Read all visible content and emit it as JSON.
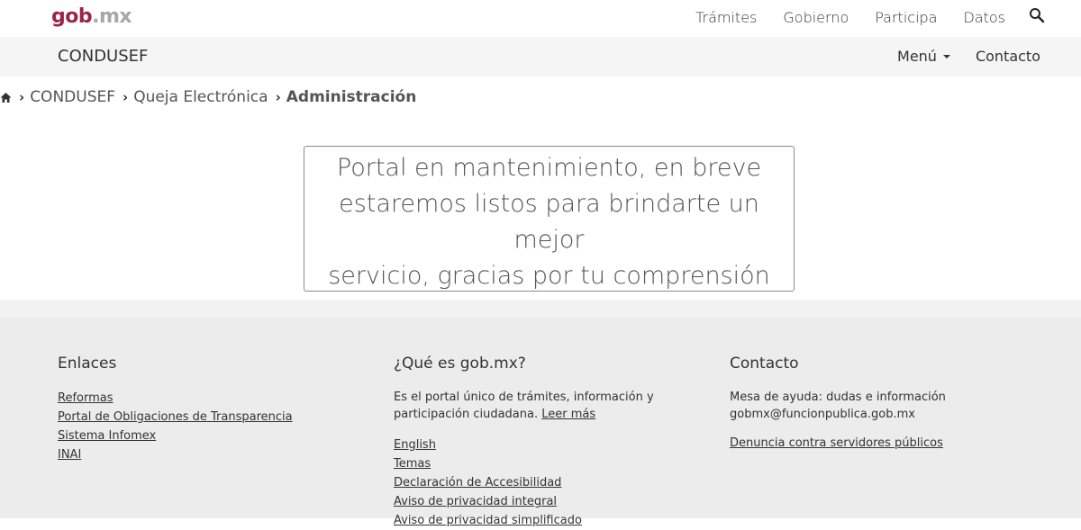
{
  "topbar": {
    "logo_gob": "gob",
    "logo_mx": ".mx",
    "nav": [
      "Trámites",
      "Gobierno",
      "Participa",
      "Datos"
    ]
  },
  "subbar": {
    "brand": "CONDUSEF",
    "menu_label": "Menú",
    "contact_label": "Contacto"
  },
  "breadcrumb": {
    "items": [
      "CONDUSEF",
      "Queja Electrónica"
    ],
    "current": "Administración"
  },
  "notice": {
    "lines": [
      "Portal en mantenimiento, en breve",
      "estaremos listos para brindarte un mejor",
      "servicio, gracias por tu comprensión"
    ]
  },
  "footer": {
    "enlaces": {
      "title": "Enlaces",
      "links": [
        "Reformas",
        "Portal de Obligaciones de Transparencia",
        "Sistema Infomex",
        "INAI"
      ]
    },
    "que_es": {
      "title": "¿Qué es gob.mx?",
      "description": "Es el portal único de trámites, información y participación ciudadana.",
      "read_more": "Leer más",
      "links": [
        "English",
        "Temas",
        "Declaración de Accesibilidad",
        "Aviso de privacidad integral",
        "Aviso de privacidad simplificado"
      ]
    },
    "contacto": {
      "title": "Contacto",
      "line1": "Mesa de ayuda: dudas e información",
      "line2": "gobmx@funcionpublica.gob.mx",
      "denuncia": "Denuncia contra servidores públicos"
    }
  },
  "colors": {
    "brand_primary": "#9d2449",
    "logo_gray": "#a7a7a7",
    "subbar_bg": "#f5f5f5",
    "footer_bg": "#ececec"
  }
}
